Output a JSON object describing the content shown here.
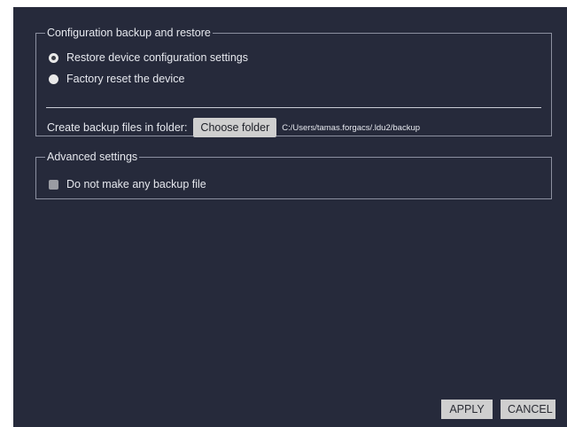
{
  "backup_section": {
    "legend": "Configuration backup and restore",
    "options": [
      {
        "label": "Restore device configuration settings",
        "selected": true
      },
      {
        "label": "Factory reset the device",
        "selected": false
      }
    ],
    "folder_label": "Create backup files in folder:",
    "choose_folder_label": "Choose folder",
    "folder_path": "C:/Users/tamas.forgacs/.ldu2/backup"
  },
  "advanced_section": {
    "legend": "Advanced settings",
    "no_backup_label": "Do not make any backup file",
    "no_backup_checked": false
  },
  "footer": {
    "apply_label": "APPLY",
    "cancel_label": "CANCEL"
  },
  "colors": {
    "panel_bg": "#262a3b",
    "text": "#e6e8ee",
    "button_bg": "#cfcfcf"
  }
}
